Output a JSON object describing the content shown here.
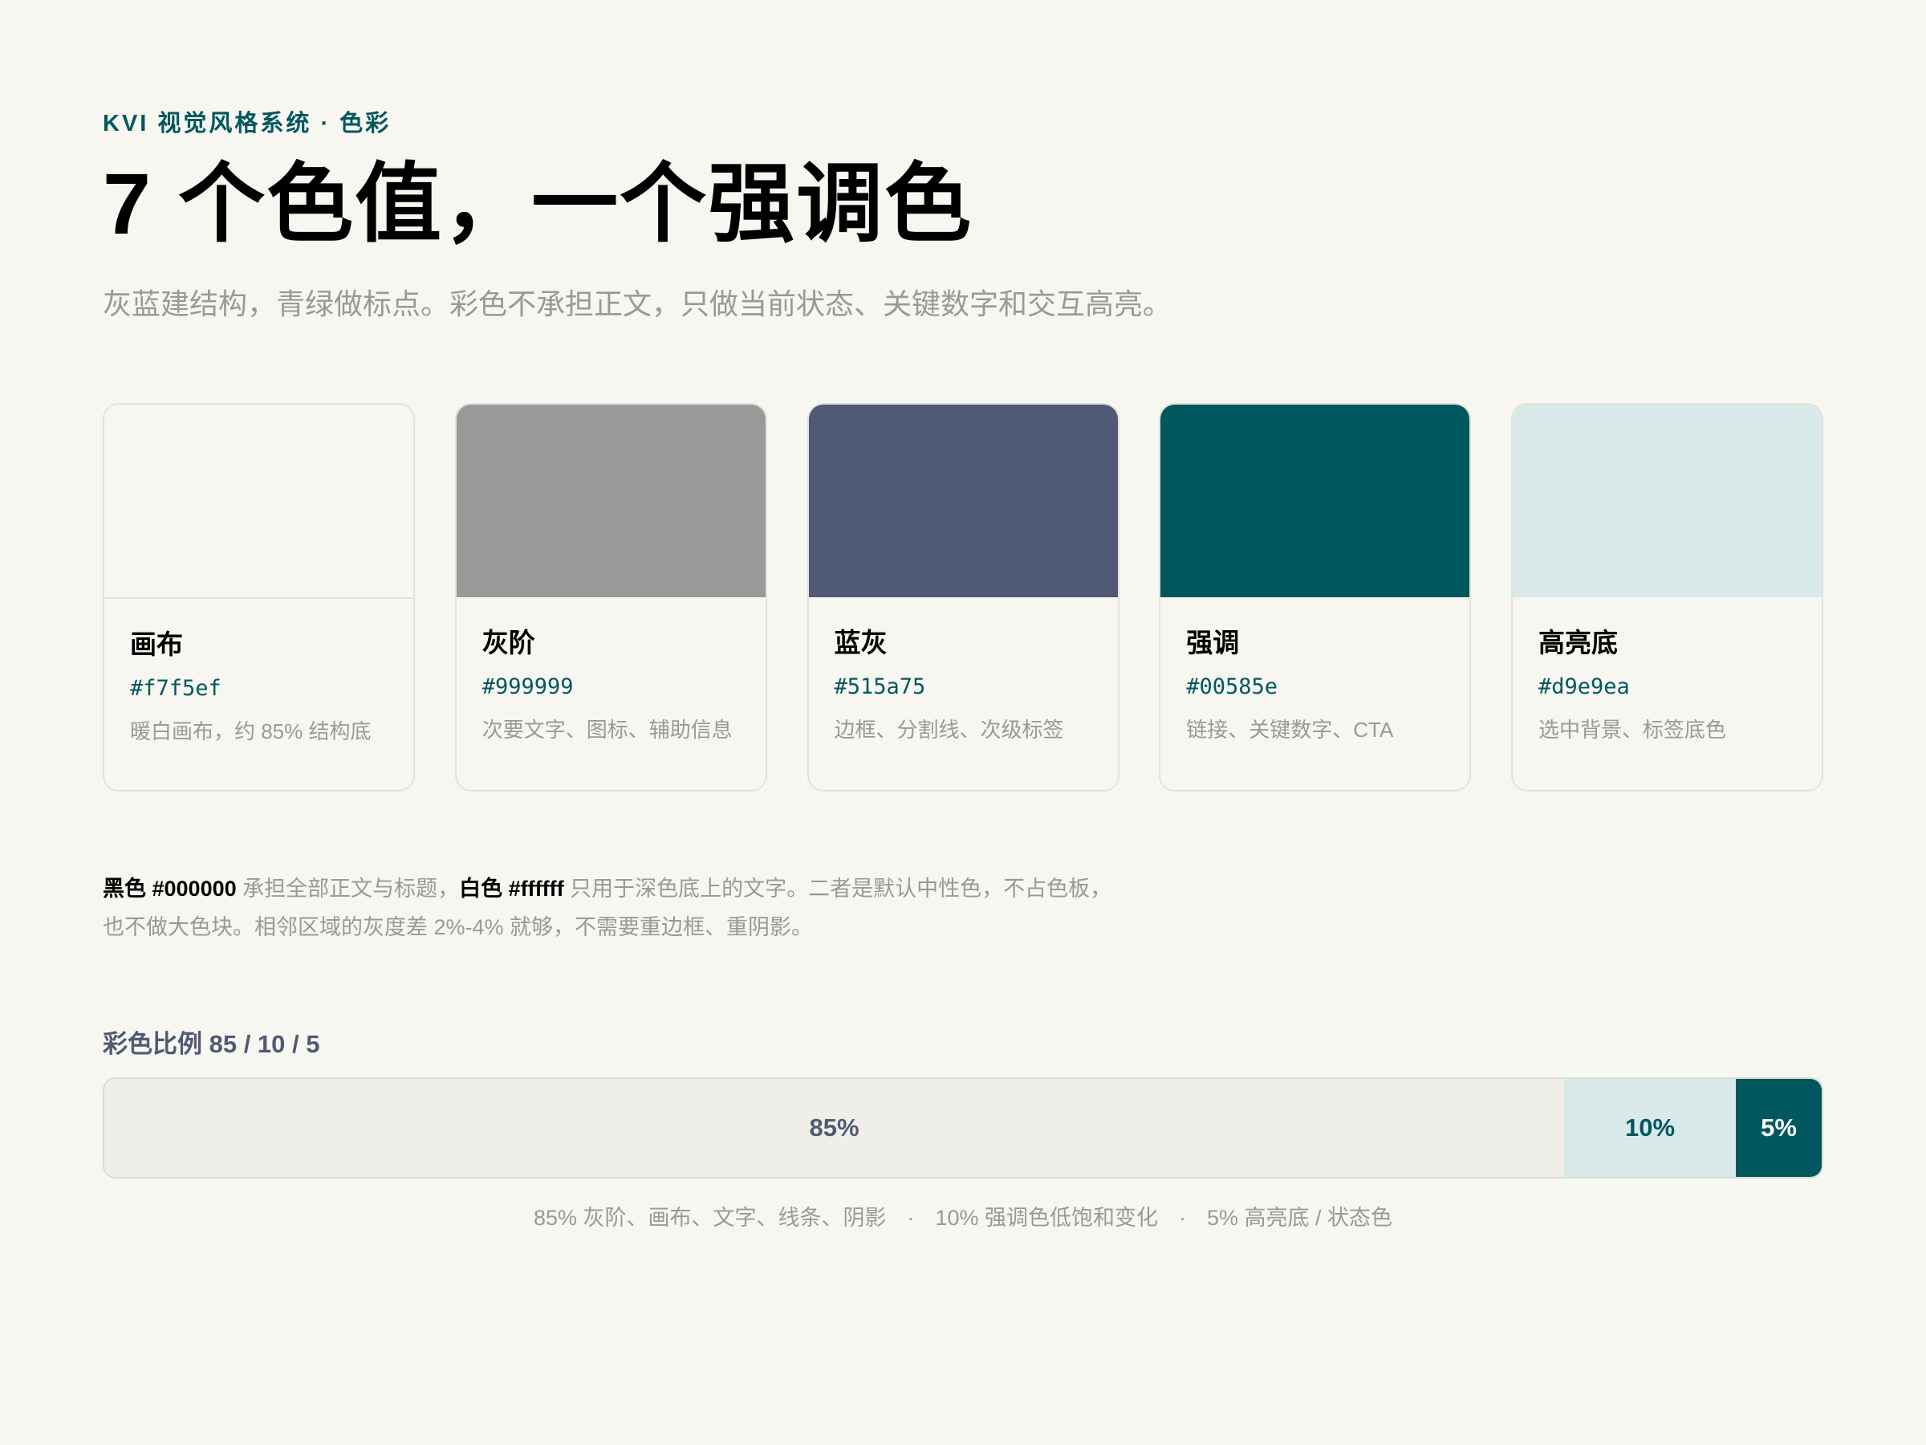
{
  "header": {
    "eyebrow": "KVI 视觉风格系统 · 色彩",
    "title": "7 个色值，一个强调色",
    "subtitle": "灰蓝建结构，青绿做标点。彩色不承担正文，只做当前状态、关键数字和交互高亮。"
  },
  "swatches": [
    {
      "name": "画布",
      "hex": "#f7f5ef",
      "color": "#f7f6f1",
      "description": "暖白画布，约 85% 结构底"
    },
    {
      "name": "灰阶",
      "hex": "#999999",
      "color": "#999999",
      "description": "次要文字、图标、辅助信息"
    },
    {
      "name": "蓝灰",
      "hex": "#515a75",
      "color": "#515a75",
      "description": "边框、分割线、次级标签"
    },
    {
      "name": "强调",
      "hex": "#00585e",
      "color": "#00585e",
      "description": "链接、关键数字、CTA"
    },
    {
      "name": "高亮底",
      "hex": "#d9e9ea",
      "color": "#d9e9ea",
      "description": "选中背景、标签底色"
    }
  ],
  "note": {
    "black_label": "黑色 #000000",
    "black_text": " 承担全部正文与标题，",
    "white_label": "白色 #ffffff",
    "white_text": " 只用于深色底上的文字。二者是默认中性色，不占色板，也不做大色块。相邻区域的灰度差 2%-4% 就够，不需要重边框、重阴影。"
  },
  "ratio": {
    "label": "彩色比例 85 / 10 / 5",
    "segments": [
      {
        "label": "85%",
        "percent": 85,
        "bg": "#efeee8",
        "fg": "#515a75"
      },
      {
        "label": "10%",
        "percent": 10,
        "bg": "#d9e9ea",
        "fg": "#00585e"
      },
      {
        "label": "5%",
        "percent": 5,
        "bg": "#00585e",
        "fg": "#ffffff"
      }
    ],
    "captions": [
      "85% 灰阶、画布、文字、线条、阴影",
      "10% 强调色低饱和变化",
      "5% 高亮底 / 状态色"
    ],
    "caption_separator": "·"
  }
}
